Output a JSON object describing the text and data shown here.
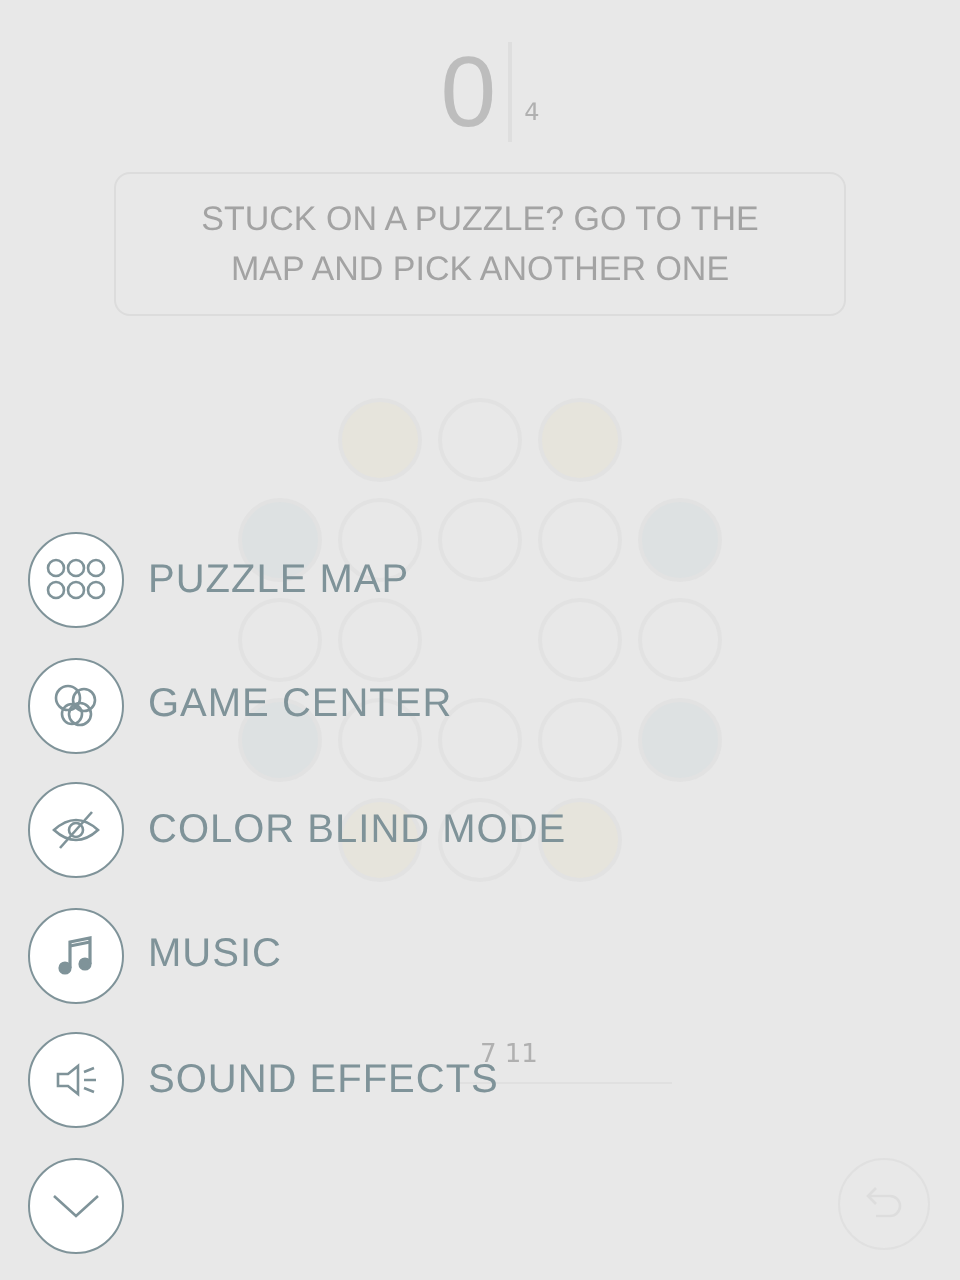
{
  "game": {
    "score": "0",
    "moves": "4",
    "hint": "STUCK ON A PUZZLE? GO TO THE MAP AND PICK ANOTHER ONE",
    "level_label": "7 11"
  },
  "menu": [
    {
      "kind": "map",
      "label": "PUZZLE MAP"
    },
    {
      "kind": "gamecenter",
      "label": "GAME CENTER"
    },
    {
      "kind": "colorblind",
      "label": "COLOR BLIND MODE"
    },
    {
      "kind": "music",
      "label": "MUSIC"
    },
    {
      "kind": "sound",
      "label": "SOUND EFFECTS"
    },
    {
      "kind": "collapse"
    }
  ]
}
